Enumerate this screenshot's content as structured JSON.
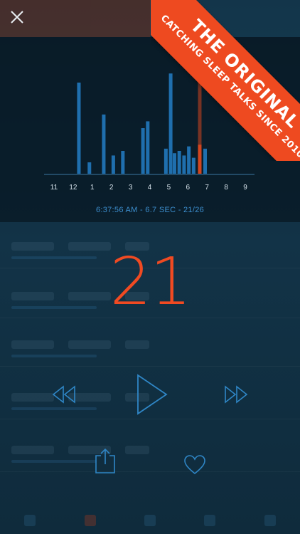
{
  "chart_data": {
    "type": "bar",
    "x_tick_labels": [
      "11",
      "12",
      "1",
      "2",
      "3",
      "4",
      "5",
      "6",
      "7",
      "8",
      "9"
    ],
    "bars": [
      {
        "hour": 12.3,
        "value": 0.8
      },
      {
        "hour": 12.85,
        "value": 0.1
      },
      {
        "hour": 1.6,
        "value": 0.52
      },
      {
        "hour": 2.1,
        "value": 0.16
      },
      {
        "hour": 2.6,
        "value": 0.2
      },
      {
        "hour": 3.65,
        "value": 0.4
      },
      {
        "hour": 3.9,
        "value": 0.46
      },
      {
        "hour": 4.85,
        "value": 0.22
      },
      {
        "hour": 5.1,
        "value": 0.88
      },
      {
        "hour": 5.3,
        "value": 0.18
      },
      {
        "hour": 5.55,
        "value": 0.2
      },
      {
        "hour": 5.8,
        "value": 0.16
      },
      {
        "hour": 6.05,
        "value": 0.24
      },
      {
        "hour": 6.3,
        "value": 0.14
      },
      {
        "hour": 6.62,
        "value": 0.85,
        "highlighted": true
      },
      {
        "hour": 6.9,
        "value": 0.22
      }
    ],
    "colors": {
      "bar": "#1f6fae",
      "highlight": "#d2451f"
    }
  },
  "recording": {
    "info": "6:37:56 AM  - 6.7 SEC - 21/26",
    "number": "21"
  },
  "banner": {
    "line1": "THE ORIGINAL",
    "line2": "CATCHING SLEEP TALKS SINCE 2010"
  },
  "icons": {
    "close": "close-icon",
    "rewind": "rewind-icon",
    "play": "play-icon",
    "fast_forward": "fast-forward-icon",
    "share": "share-icon",
    "favorite": "heart-icon"
  },
  "colors": {
    "accent": "#f04a22",
    "control": "#2f86c6",
    "info": "#3d8fcf"
  }
}
